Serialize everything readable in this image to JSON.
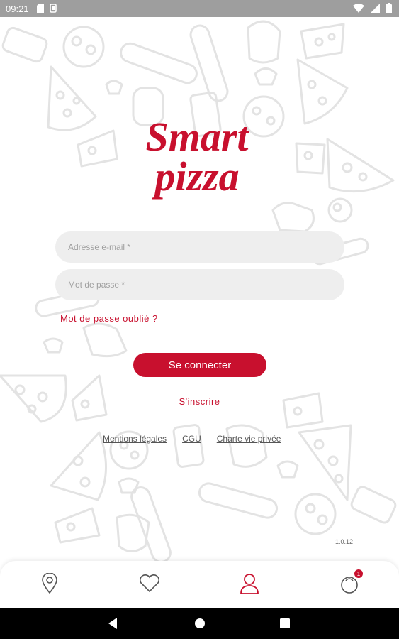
{
  "status_bar": {
    "time": "09:21"
  },
  "login": {
    "email_placeholder": "Adresse e-mail *",
    "password_placeholder": "Mot de passe *",
    "forgot_password": "Mot de passe oublié ?",
    "connect_button": "Se connecter",
    "signup_link": "S'inscrire"
  },
  "legal_links": [
    "Mentions légales",
    "CGU",
    "Charte vie privée"
  ],
  "version": "1.0.12",
  "bottom_nav": {
    "items": [
      "location-pin-icon",
      "heart-icon",
      "user-icon",
      "cart-icon"
    ],
    "active": "user-icon",
    "cart_badge": "1"
  },
  "colors": {
    "accent": "#c8102e",
    "doodle": "#e6e6e6",
    "field_bg": "#eeeeee"
  }
}
